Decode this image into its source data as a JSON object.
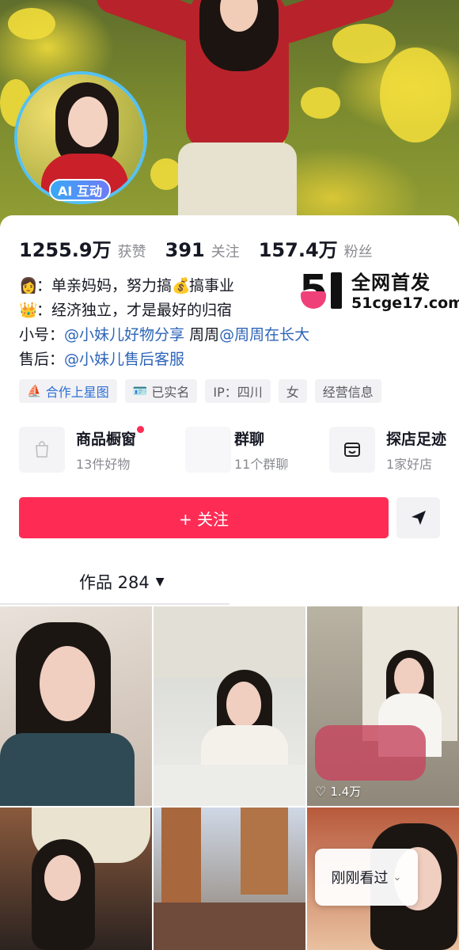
{
  "hero": {
    "ai_badge": "AI 互动"
  },
  "stats": [
    {
      "num": "1255.9万",
      "label": "获赞"
    },
    {
      "num": "391",
      "label": "关注"
    },
    {
      "num": "157.4万",
      "label": "粉丝"
    }
  ],
  "bio": {
    "line1_prefix": "：单亲妈妈，努力搞",
    "line1_suffix": "搞事业",
    "line2": "：经济独立，才是最好的归宿",
    "line3_label": "小号：",
    "line3_link1": "@小妹儿好物分享",
    "line3_mid": " 周周",
    "line3_link2": "@周周在长大",
    "line4_label": "售后：",
    "line4_link": "@小妹儿售后客服",
    "icons": [
      "person-emoji-icon",
      "money-bag-icon",
      "crown-icon"
    ]
  },
  "watermark": {
    "line1": "全网首发",
    "line2": "51cge17.com"
  },
  "tags": [
    {
      "label": "合作上星图",
      "icon": "star-map-icon"
    },
    {
      "label": "已实名",
      "icon": "id-card-icon"
    },
    {
      "label": "IP：四川"
    },
    {
      "label": "女"
    },
    {
      "label": "经营信息"
    }
  ],
  "features": [
    {
      "title": "商品橱窗",
      "sub": "13件好物",
      "icon": "shop-bag-icon"
    },
    {
      "title": "群聊",
      "sub": "11个群聊"
    },
    {
      "title": "探店足迹",
      "sub": "1家好店",
      "icon": "store-icon"
    }
  ],
  "actions": {
    "follow": "+ 关注",
    "share_icon": "send-icon"
  },
  "works": {
    "label": "作品 284"
  },
  "grid": {
    "likes_cell3": "1.4万",
    "recent_label": "刚刚看过"
  },
  "colors": {
    "accent": "#fe2c55",
    "link": "#2c64b8",
    "avatar_ring": "#54c1f3"
  }
}
